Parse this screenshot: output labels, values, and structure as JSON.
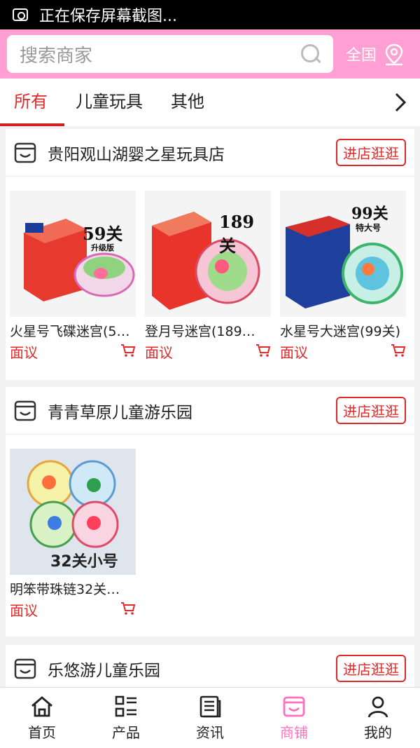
{
  "status_bar": {
    "text": "正在保存屏幕截图..."
  },
  "search": {
    "placeholder": "搜索商家",
    "region": "全国"
  },
  "tabs": [
    {
      "label": "所有"
    },
    {
      "label": "儿童玩具"
    },
    {
      "label": "其他"
    }
  ],
  "shops": [
    {
      "name": "贵阳观山湖婴之星玩具店",
      "visit_label": "进店逛逛",
      "products": [
        {
          "name": "火星号飞碟迷宫(5…",
          "price": "面议",
          "image_text": "59关",
          "image_sub": "升级版"
        },
        {
          "name": "登月号迷宫(189…",
          "price": "面议",
          "image_text": "189关",
          "image_sub": ""
        },
        {
          "name": "水星号大迷宫(99关)",
          "price": "面议",
          "image_text": "99关",
          "image_sub": "特大号"
        }
      ]
    },
    {
      "name": "青青草原儿童游乐园",
      "visit_label": "进店逛逛",
      "products": [
        {
          "name": "明笨带珠链32关…",
          "price": "面议",
          "image_text": "32关小号",
          "image_sub": ""
        }
      ]
    },
    {
      "name": "乐悠游儿童乐园",
      "visit_label": "进店逛逛",
      "products": []
    }
  ],
  "bottom_nav": [
    {
      "label": "首页",
      "icon": "home-icon"
    },
    {
      "label": "产品",
      "icon": "grid-list-icon"
    },
    {
      "label": "资讯",
      "icon": "news-icon"
    },
    {
      "label": "商铺",
      "icon": "store-icon"
    },
    {
      "label": "我的",
      "icon": "user-icon"
    }
  ],
  "colors": {
    "brand_pink": "#ff9fd3",
    "accent_red": "#e02a2a",
    "nav_active": "#ff70c0"
  }
}
